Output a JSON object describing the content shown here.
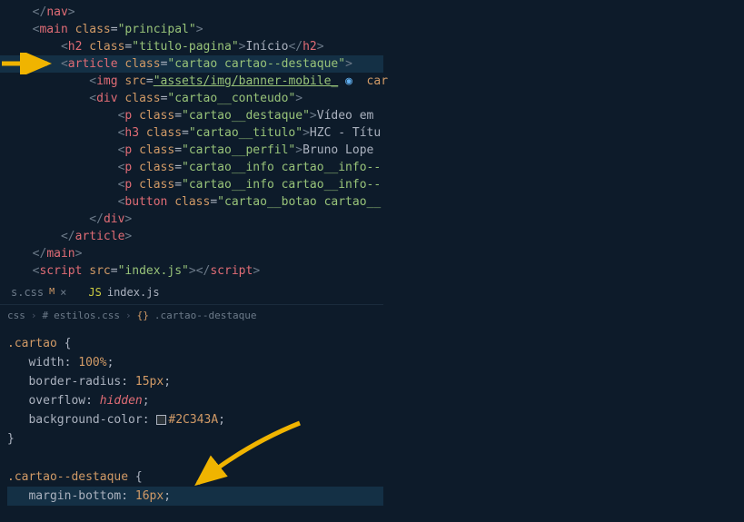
{
  "top_code": {
    "l1": "</nav>",
    "l2_open": "<main ",
    "l2_attr": "class",
    "l2_val": "\"principal\"",
    "l2_close": ">",
    "l3_open": "<h2 ",
    "l3_attr": "class",
    "l3_val": "\"titulo-pagina\"",
    "l3_mid": ">",
    "l3_text": "Início",
    "l3_close": "</h2>",
    "l4_open": "<article ",
    "l4_attr": "class",
    "l4_val": "\"cartao cartao--destaque\"",
    "l4_close": ">",
    "l5_open": "<img ",
    "l5_attr": "src",
    "l5_val": "\"assets/img/banner-mobile_",
    "l5_trail": " car",
    "l6_open": "<div ",
    "l6_attr": "class",
    "l6_val": "\"cartao__conteudo\"",
    "l6_close": ">",
    "l7_open": "<p ",
    "l7_attr": "class",
    "l7_val": "\"cartao__destaque\"",
    "l7_mid": ">",
    "l7_text": "Vídeo em ",
    "l8_open": "<h3 ",
    "l8_attr": "class",
    "l8_val": "\"cartao__titulo\"",
    "l8_mid": ">",
    "l8_text": "HZC - Títu",
    "l9_open": "<p ",
    "l9_attr": "class",
    "l9_val": "\"cartao__perfil\"",
    "l9_mid": ">",
    "l9_text": "Bruno Lope",
    "l10_open": "<p ",
    "l10_attr": "class",
    "l10_val": "\"cartao__info cartao__info--",
    "l11_open": "<p ",
    "l11_attr": "class",
    "l11_val": "\"cartao__info cartao__info--",
    "l12_open": "<button ",
    "l12_attr": "class",
    "l12_val": "\"cartao__botao cartao__",
    "l13": "</div>",
    "l14": "</article>",
    "l15": "</main>",
    "l16_open": "<script ",
    "l16_attr": "src",
    "l16_val": "\"index.js\"",
    "l16_mid": ">",
    "l16_close": "</",
    "l16_scr": "script",
    "l16_end": ">"
  },
  "tabs": {
    "t1_label": "s.css",
    "t1_m": "M",
    "t2_label": "index.js"
  },
  "breadcrumb": {
    "p1": "css",
    "p2": "estilos.css",
    "p3": ".cartao--destaque"
  },
  "css": {
    "sel1": ".cartao",
    "p1": "width",
    "v1": "100%",
    "p2": "border-radius",
    "v2": "15px",
    "p3": "overflow",
    "v3": "hidden",
    "p4": "background-color",
    "v4": "#2C343A",
    "sel2": ".cartao--destaque",
    "p5": "margin-bottom",
    "v5": "16px"
  },
  "icons": {
    "eye": "◉"
  }
}
